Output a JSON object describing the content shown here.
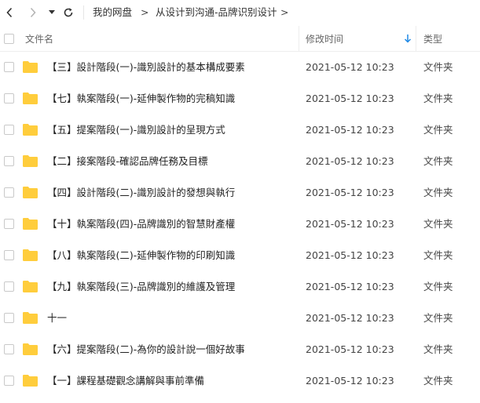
{
  "toolbar": {
    "back_icon": "chevron-left-icon",
    "forward_icon": "chevron-right-icon",
    "dropdown_icon": "caret-down-icon",
    "refresh_icon": "refresh-icon",
    "breadcrumb": [
      "我的网盘",
      "从设计到沟通-品牌识别设计"
    ],
    "separator": ">"
  },
  "header": {
    "name": "文件名",
    "modified": "修改时间",
    "type": "类型",
    "sort_icon": "arrow-down-icon",
    "sort_color": "#1e88e5"
  },
  "folder_color": "#ffcd3c",
  "files": [
    {
      "name": "【三】設計階段(一)-識別設計的基本構成要素",
      "time": "2021-05-12 10:23",
      "type": "文件夹"
    },
    {
      "name": "【七】執案階段(一)-延伸製作物的完稿知識",
      "time": "2021-05-12 10:23",
      "type": "文件夹"
    },
    {
      "name": "【五】提案階段(一)-識別設計的呈現方式",
      "time": "2021-05-12 10:23",
      "type": "文件夹"
    },
    {
      "name": "【二】接案階段-確認品牌任務及目標",
      "time": "2021-05-12 10:23",
      "type": "文件夹"
    },
    {
      "name": "【四】設計階段(二)-識別設計的發想與執行",
      "time": "2021-05-12 10:23",
      "type": "文件夹"
    },
    {
      "name": "【十】執案階段(四)-品牌識別的智慧財產權",
      "time": "2021-05-12 10:23",
      "type": "文件夹"
    },
    {
      "name": "【八】執案階段(二)-延伸製作物的印刷知識",
      "time": "2021-05-12 10:23",
      "type": "文件夹"
    },
    {
      "name": "【九】執案階段(三)-品牌識別的維護及管理",
      "time": "2021-05-12 10:23",
      "type": "文件夹"
    },
    {
      "name": "十一",
      "time": "2021-05-12 10:23",
      "type": "文件夹"
    },
    {
      "name": "【六】提案階段(二)-為你的設計說一個好故事",
      "time": "2021-05-12 10:23",
      "type": "文件夹"
    },
    {
      "name": "【一】課程基礎觀念講解與事前準備",
      "time": "2021-05-12 10:23",
      "type": "文件夹"
    }
  ]
}
